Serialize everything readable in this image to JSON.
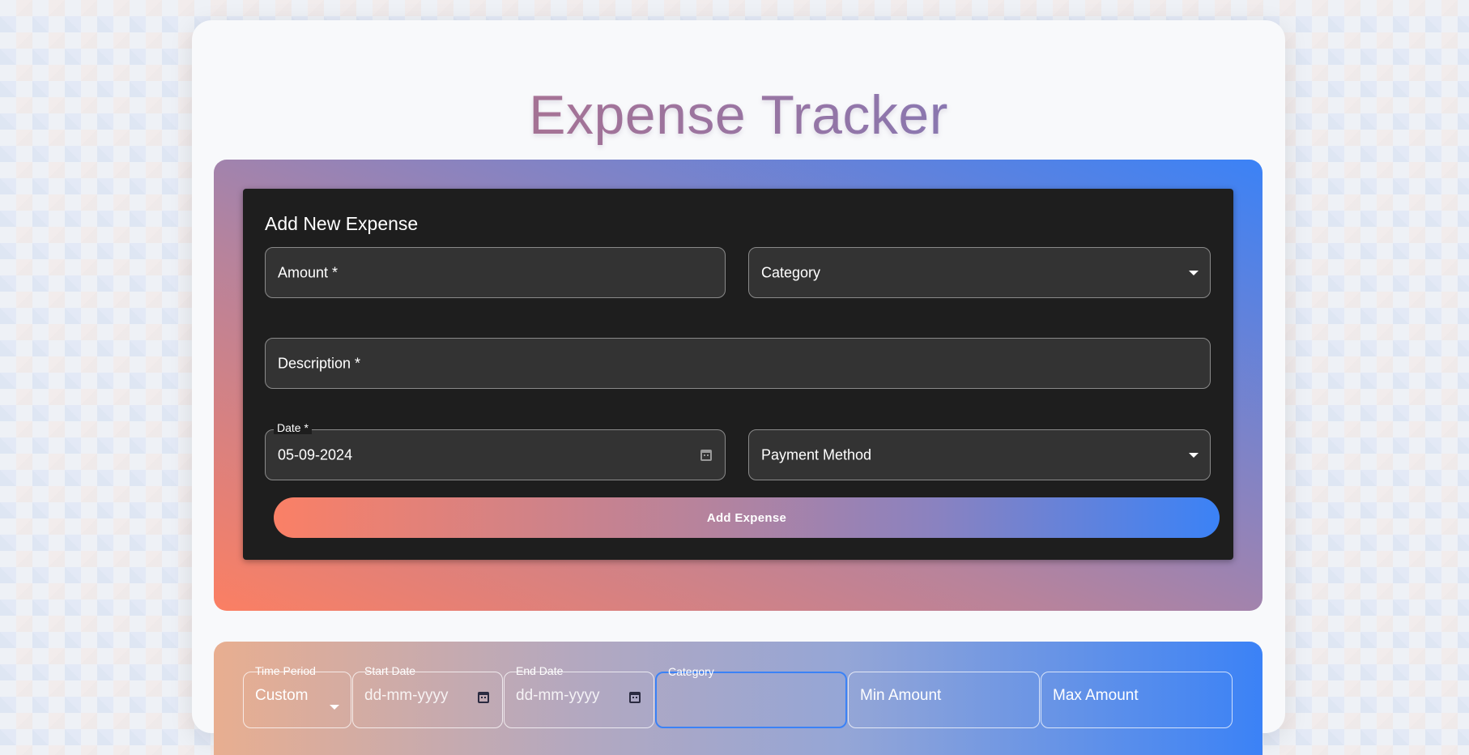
{
  "app": {
    "title": "Expense Tracker"
  },
  "add_form": {
    "title": "Add New Expense",
    "amount_label": "Amount *",
    "category_label": "Category",
    "description_label": "Description *",
    "date_label": "Date *",
    "date_value": "05-09-2024",
    "payment_method_label": "Payment Method",
    "submit_label": "Add Expense"
  },
  "filters": {
    "time_period_label": "Time Period",
    "time_period_value": "Custom",
    "start_date_label": "Start Date",
    "start_date_placeholder": "dd-mm-yyyy",
    "end_date_label": "End Date",
    "end_date_placeholder": "dd-mm-yyyy",
    "category_label": "Category",
    "min_amount_label": "Min Amount",
    "max_amount_label": "Max Amount"
  },
  "colors": {
    "accent_blue": "#3b82f6",
    "accent_coral": "#fb7f63",
    "card_dark": "#1e1e1e",
    "field_bg": "#333333"
  },
  "icons": [
    "chevron-down-icon",
    "calendar-icon"
  ]
}
